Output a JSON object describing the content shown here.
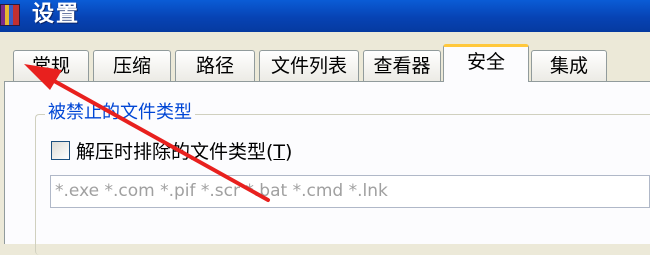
{
  "window": {
    "title": "设置"
  },
  "tabs": [
    {
      "label": "常规",
      "active": false
    },
    {
      "label": "压缩",
      "active": false
    },
    {
      "label": "路径",
      "active": false
    },
    {
      "label": "文件列表",
      "active": false
    },
    {
      "label": "查看器",
      "active": false
    },
    {
      "label": "安全",
      "active": true
    },
    {
      "label": "集成",
      "active": false
    }
  ],
  "security": {
    "group_title": "被禁止的文件类型",
    "checkbox_label": "解压时排除的文件类型(",
    "checkbox_hotkey": "T",
    "checkbox_label_end": ")",
    "checkbox_checked": false,
    "file_types_value": "*.exe *.com *.pif *.scr *.bat *.cmd *.lnk"
  },
  "colors": {
    "title_bar": "#0a5cd6",
    "active_tab_accent": "#ffc83c",
    "group_title": "#0046d5",
    "annotation_arrow": "#e8201e"
  }
}
